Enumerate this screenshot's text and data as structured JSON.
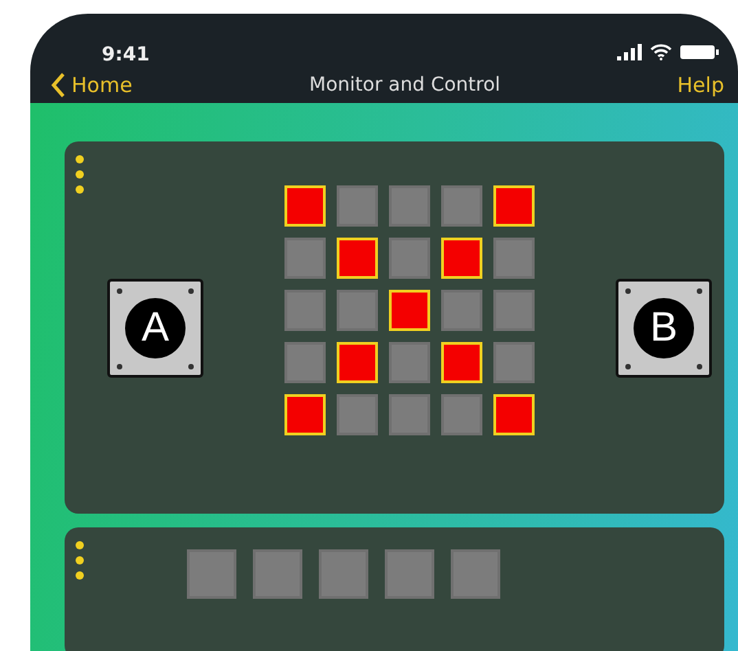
{
  "status_bar": {
    "time": "9:41"
  },
  "nav": {
    "back": "Home",
    "title": "Monitor and Control",
    "action": "Help"
  },
  "panels": [
    {
      "kind": "matrix",
      "buttons": [
        {
          "label": "A"
        },
        {
          "label": "B"
        }
      ],
      "leds": [
        [
          {
            "on": true
          },
          {
            "on": false
          },
          {
            "on": false
          },
          {
            "on": false
          },
          {
            "on": true
          }
        ],
        [
          {
            "on": false
          },
          {
            "on": true
          },
          {
            "on": false
          },
          {
            "on": true
          },
          {
            "on": false
          }
        ],
        [
          {
            "on": false
          },
          {
            "on": false
          },
          {
            "on": true
          },
          {
            "on": false
          },
          {
            "on": false
          }
        ],
        [
          {
            "on": false
          },
          {
            "on": true
          },
          {
            "on": false
          },
          {
            "on": true
          },
          {
            "on": false
          }
        ],
        [
          {
            "on": true
          },
          {
            "on": false
          },
          {
            "on": false
          },
          {
            "on": false
          },
          {
            "on": true
          }
        ]
      ]
    },
    {
      "kind": "row",
      "leds": [
        [
          {
            "on": false
          },
          {
            "on": false
          },
          {
            "on": false
          },
          {
            "on": false
          },
          {
            "on": false
          }
        ]
      ]
    }
  ]
}
